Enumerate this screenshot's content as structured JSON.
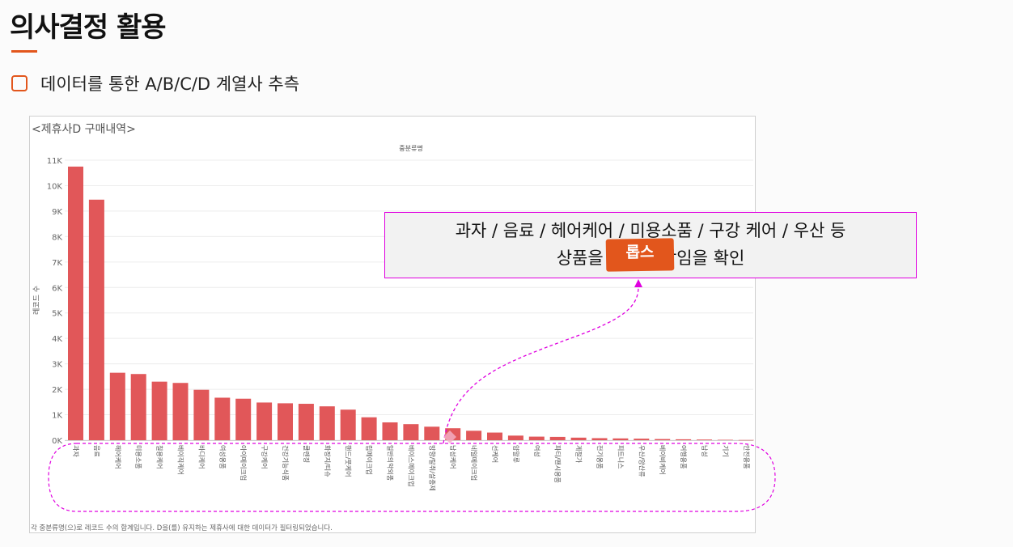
{
  "page": {
    "title": "의사결정 활용",
    "bullet": "데이터를 통한 A/B/C/D 계열사 추측"
  },
  "callout": {
    "line1": "과자 / 음료 / 헤어케어 / 미용소품 / 구강 케어 / 우산 등",
    "line2": "상품을 통해               매장임을 확인",
    "badge": "롭스"
  },
  "colors": {
    "accent": "#e2561c",
    "bar": "#e15759",
    "annotation": "#e000e0"
  },
  "chart_data": {
    "type": "bar",
    "title": "<제휴사D 구매내역>",
    "subtitle": "중분류명",
    "ylabel": "레코드 수",
    "footnote": "각 중분류명(으)로 레코드 수의 합계입니다. D을(를) 유지하는 제휴사에 대한 데이터가 필터링되었습니다.",
    "ylim": [
      0,
      11000
    ],
    "yticks": [
      0,
      1000,
      2000,
      3000,
      4000,
      5000,
      6000,
      7000,
      8000,
      9000,
      10000,
      11000
    ],
    "ytick_labels": [
      "0K",
      "1K",
      "2K",
      "3K",
      "4K",
      "5K",
      "6K",
      "7K",
      "8K",
      "9K",
      "10K",
      "11K"
    ],
    "grid": true,
    "categories": [
      "과자",
      "음료",
      "헤어케어",
      "미용소품",
      "칠용케어",
      "베이직케어",
      "바디케어",
      "여성용품",
      "아이메이크업",
      "구강케어",
      "건강기능식품",
      "클렌징",
      "화장지/티슈",
      "핸드/풋케어",
      "립메이크업",
      "일반의약외품",
      "베이스메이크업",
      "방향/탈취/살충제",
      "남성케어",
      "네일메이크업",
      "선케어",
      "양말류",
      "여성",
      "파티/팬시용품",
      "계절가",
      "전기용품",
      "피트니스",
      "우산/양산류",
      "베이비케어",
      "여행용품",
      "남성",
      "기기",
      "안전용품"
    ],
    "values": [
      10750,
      9450,
      2650,
      2600,
      2300,
      2250,
      1980,
      1670,
      1630,
      1480,
      1450,
      1430,
      1330,
      1200,
      900,
      700,
      630,
      530,
      470,
      370,
      300,
      180,
      140,
      130,
      100,
      80,
      70,
      60,
      45,
      35,
      25,
      15,
      8
    ]
  }
}
